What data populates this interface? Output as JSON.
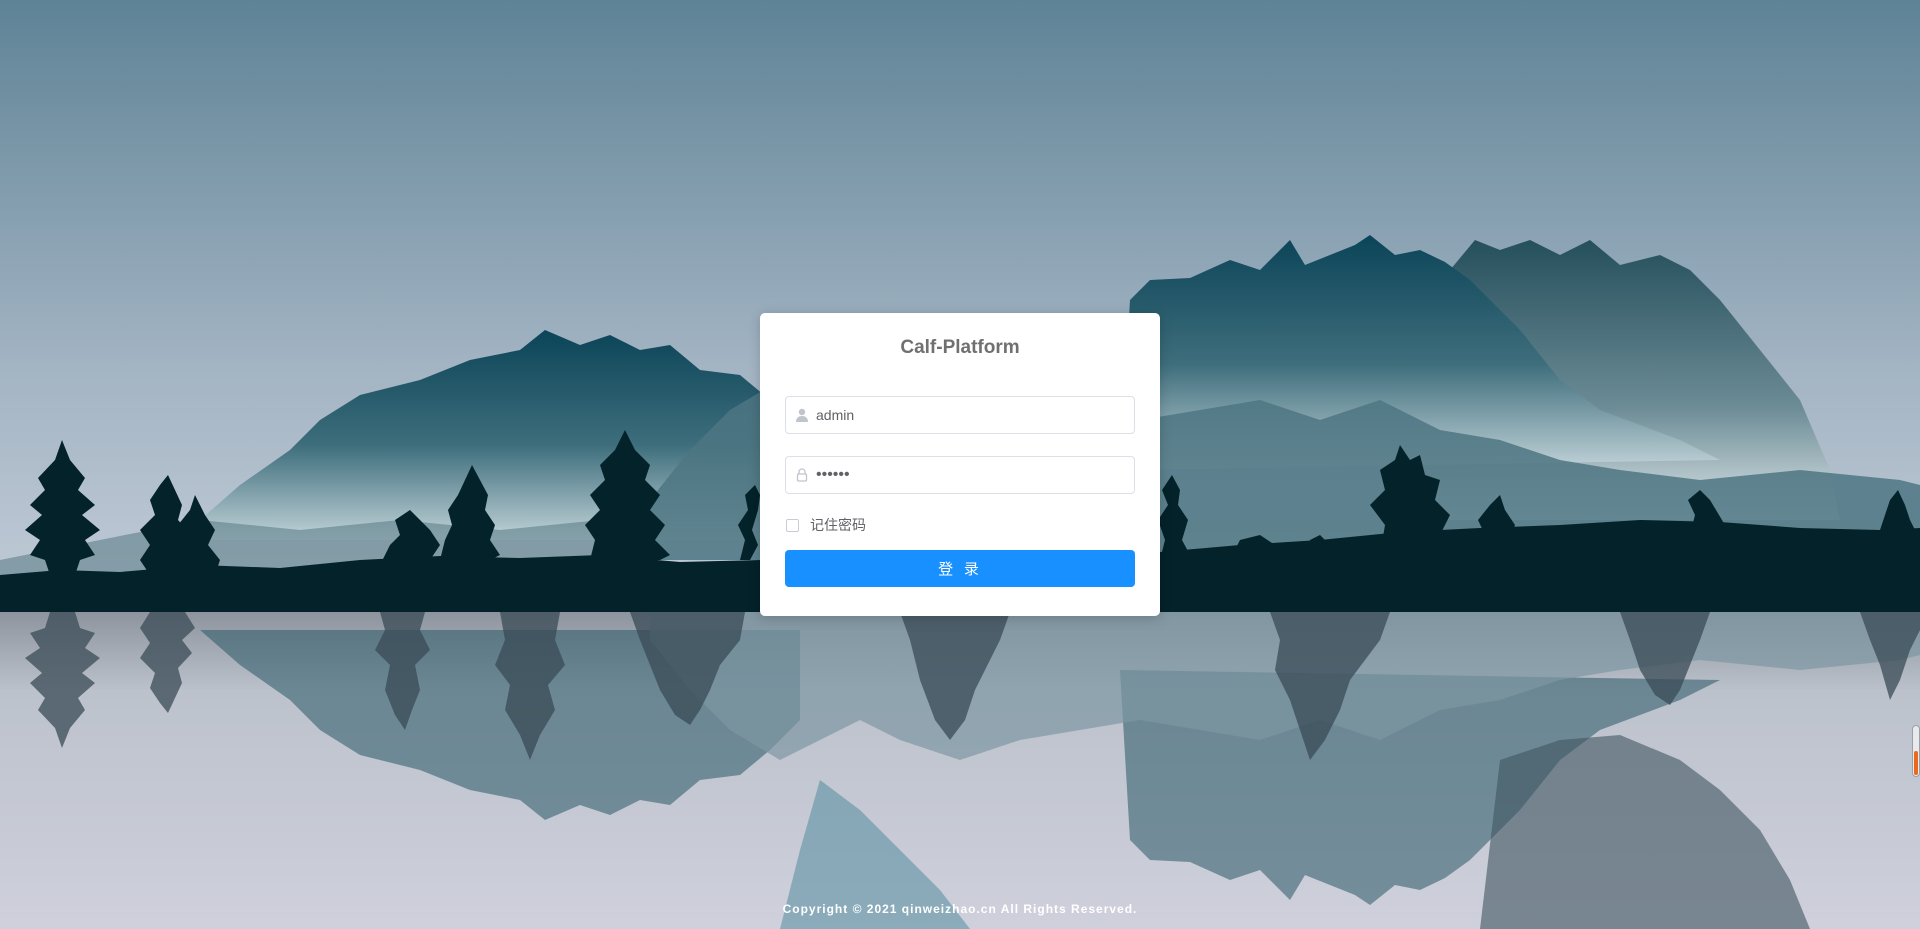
{
  "page": {
    "background_image": "mountain-lake-landscape"
  },
  "login": {
    "title": "Calf-Platform",
    "username_value": "admin",
    "username_icon": "user-icon",
    "password_value": "123456",
    "password_icon": "lock-icon",
    "remember_label": "记住密码",
    "remember_checked": false,
    "submit_label": "登 录"
  },
  "footer": {
    "copyright": "Copyright © 2021 qinweizhao.cn All Rights Reserved."
  },
  "colors": {
    "primary": "#1890ff",
    "card": "#ffffff",
    "title": "#707070",
    "forest": "#042229",
    "mountain_dark": "#0e4a5c"
  }
}
